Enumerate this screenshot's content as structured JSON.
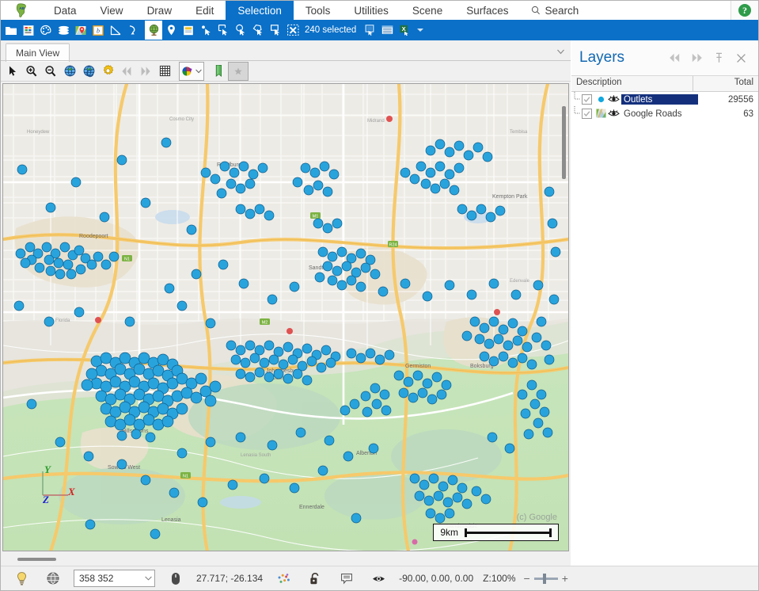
{
  "app": {
    "logo_name": "africa-logo",
    "accent_blue": "#0a70c8",
    "selection_navy": "#14307d",
    "marker_cyan": "#1a9dd9"
  },
  "menubar": {
    "items": [
      {
        "label": "Data",
        "active": false
      },
      {
        "label": "View",
        "active": false
      },
      {
        "label": "Draw",
        "active": false
      },
      {
        "label": "Edit",
        "active": false
      },
      {
        "label": "Selection",
        "active": true
      },
      {
        "label": "Tools",
        "active": false
      },
      {
        "label": "Utilities",
        "active": false
      },
      {
        "label": "Scene",
        "active": false
      },
      {
        "label": "Surfaces",
        "active": false
      }
    ],
    "search_label": "Search",
    "search_icon": "search-icon",
    "help_label": "?"
  },
  "ribbon": {
    "status_text": "240 selected",
    "buttons": [
      {
        "name": "open-folder-button",
        "icon": "folder-icon"
      },
      {
        "name": "data-table-button",
        "icon": "spreadsheet-icon"
      },
      {
        "name": "palette-button",
        "icon": "color-palette-icon"
      },
      {
        "name": "layers-stack-button",
        "icon": "layers-icon"
      },
      {
        "name": "google-map-button",
        "icon": "map-pin-icon"
      },
      {
        "name": "boundary-button",
        "icon": "boundary-icon"
      },
      {
        "name": "measure-button",
        "icon": "ruler-icon"
      },
      {
        "name": "route-button",
        "icon": "route-icon"
      },
      {
        "name": "globe-button",
        "icon": "globe-icon"
      },
      {
        "name": "pin-marker-button",
        "icon": "location-pin-icon"
      },
      {
        "name": "label-button",
        "icon": "label-icon"
      },
      {
        "name": "select-point-button",
        "icon": "select-arrow-icon"
      },
      {
        "name": "select-rect-button",
        "icon": "select-rectangle-icon"
      },
      {
        "name": "select-circle-button",
        "icon": "select-circle-icon"
      },
      {
        "name": "select-polygon-button",
        "icon": "select-polygon-icon"
      },
      {
        "name": "select-box-button",
        "icon": "select-box-icon"
      },
      {
        "name": "clear-selection-button",
        "icon": "clear-selection-icon"
      },
      {
        "name": "selection-to-layer-button",
        "icon": "copy-selection-icon"
      },
      {
        "name": "selection-table-button",
        "icon": "table-rows-icon"
      },
      {
        "name": "export-excel-button",
        "icon": "excel-icon"
      }
    ],
    "overflow_icon": "chevron-down-icon"
  },
  "view": {
    "tabs": [
      {
        "label": "Main View",
        "active": true
      }
    ],
    "tab_overflow_icon": "chevron-down-icon",
    "toolbar": [
      {
        "name": "pointer-tool",
        "icon": "cursor-arrow-icon"
      },
      {
        "name": "zoom-in-tool",
        "icon": "magnifier-plus-icon"
      },
      {
        "name": "zoom-out-tool",
        "icon": "magnifier-minus-icon"
      },
      {
        "name": "zoom-extents-tool",
        "icon": "globe-icon"
      },
      {
        "name": "zoom-previous-tool",
        "icon": "globe-refresh-icon"
      },
      {
        "name": "view-settings-tool",
        "icon": "gear-icon"
      },
      {
        "name": "step-back-tool",
        "icon": "double-chevron-left-icon"
      },
      {
        "name": "step-forward-tool",
        "icon": "double-chevron-right-icon"
      },
      {
        "name": "grid-tool",
        "icon": "grid-icon"
      },
      {
        "name": "theme-color-tool",
        "icon": "color-wheel-icon"
      },
      {
        "name": "bookmark-tool",
        "icon": "bookmark-icon"
      },
      {
        "name": "favorite-tool",
        "icon": "star-icon"
      }
    ]
  },
  "map": {
    "scale_label": "9km",
    "attribution": "(c) Google",
    "axes": {
      "x": "X",
      "y": "Y",
      "z": "Z",
      "x_color": "#d42020",
      "y_color": "#2d9b2d",
      "z_color": "#2020d4"
    }
  },
  "layers": {
    "title": "Layers",
    "header_buttons": [
      {
        "name": "collapse-left-button",
        "icon": "double-chevron-left-icon"
      },
      {
        "name": "expand-right-button",
        "icon": "double-chevron-right-icon"
      },
      {
        "name": "pin-panel-button",
        "icon": "pin-icon"
      },
      {
        "name": "close-panel-button",
        "icon": "close-icon"
      }
    ],
    "columns": {
      "description": "Description",
      "total": "Total"
    },
    "rows": [
      {
        "name": "Outlets",
        "total": "29556",
        "checked": true,
        "selected": true,
        "symbol": "cyan-dot-icon",
        "visibility_icon": "eye-icon"
      },
      {
        "name": "Google Roads",
        "total": "63",
        "checked": true,
        "selected": false,
        "symbol": "map-tile-icon",
        "visibility_icon": "eye-icon"
      }
    ]
  },
  "statusbar": {
    "lightbulb_icon": "lightbulb-icon",
    "globe_icon": "globe-wire-icon",
    "record_count": "358 352",
    "mouse_icon": "mouse-icon",
    "coordinates": "27.717; -26.134",
    "scatter_icon": "scatter-points-icon",
    "lock_icon": "unlocked-padlock-icon",
    "note_icon": "note-icon",
    "eye_icon": "eye-icon",
    "camera_values": "-90.00, 0.00, 0.00",
    "zoom_label": "Z:100%",
    "zoom_out_sign": "−",
    "zoom_in_sign": "+"
  }
}
